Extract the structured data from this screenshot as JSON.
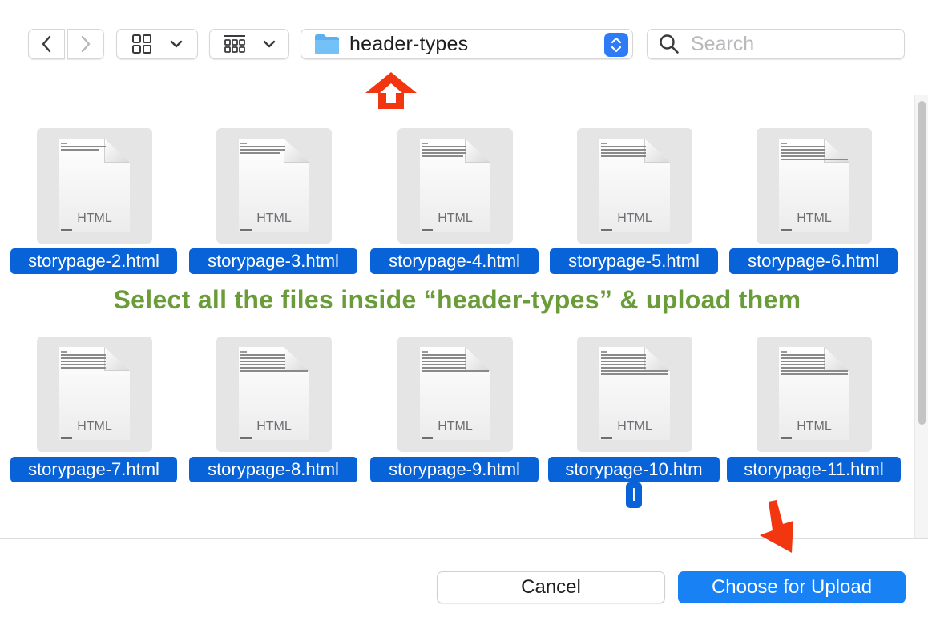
{
  "toolbar": {
    "back_icon": "chevron-left-icon",
    "forward_icon": "chevron-right-icon",
    "view_grid_icon": "grid-view-icon",
    "view_gallery_icon": "gallery-view-icon",
    "folder_icon": "folder-icon",
    "location": "header-types",
    "search_placeholder": "Search",
    "accent": "#2f7bf5"
  },
  "files": [
    {
      "name": "storypage-2.html",
      "type": "HTML"
    },
    {
      "name": "storypage-3.html",
      "type": "HTML"
    },
    {
      "name": "storypage-4.html",
      "type": "HTML"
    },
    {
      "name": "storypage-5.html",
      "type": "HTML"
    },
    {
      "name": "storypage-6.html",
      "type": "HTML"
    },
    {
      "name": "storypage-7.html",
      "type": "HTML"
    },
    {
      "name": "storypage-8.html",
      "type": "HTML"
    },
    {
      "name": "storypage-9.html",
      "type": "HTML"
    },
    {
      "name": "storypage-10.htm",
      "type": "HTML",
      "name_cont": "l"
    },
    {
      "name": "storypage-11.html",
      "type": "HTML"
    }
  ],
  "annotation": {
    "instruction": "Select all the files inside “header-types” & upload them",
    "instruction_color": "#6b9c3a",
    "arrow_color": "#f2360f"
  },
  "footer": {
    "cancel_label": "Cancel",
    "upload_label": "Choose for Upload"
  }
}
